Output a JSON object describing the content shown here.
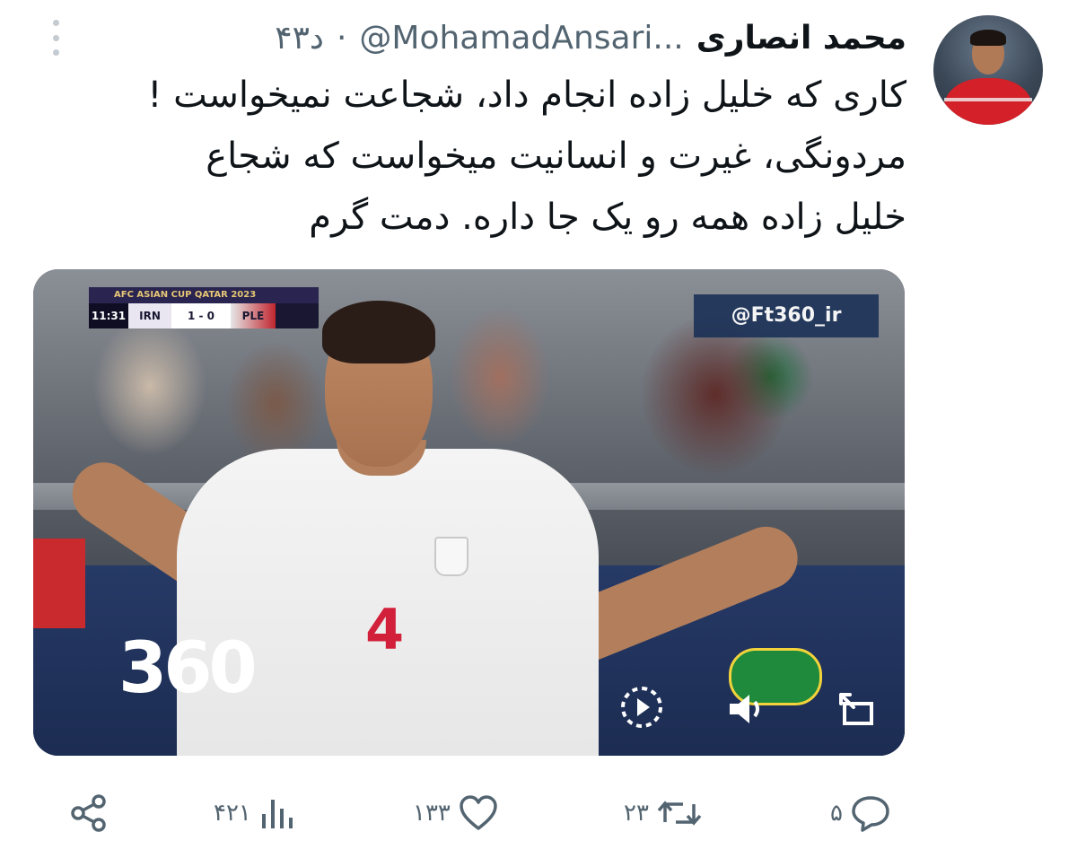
{
  "author": {
    "display_name": "محمد انصاری",
    "handle": "@MohamadAnsari...",
    "separator": "·",
    "time": "۴۳د"
  },
  "tweet": {
    "lines": [
      "کاری که خلیل زاده انجام داد، شجاعت نمیخواست !",
      "مردونگی، غیرت و انسانیت میخواست که شجاع",
      "خلیل زاده همه رو یک جا داره. دمت گرم"
    ]
  },
  "media": {
    "scorebug": {
      "title": "AFC ASIAN CUP QATAR 2023",
      "clock": "11:31",
      "home": "IRN",
      "score": "1 - 0",
      "away": "PLE"
    },
    "watermark": "@Ft360_ir",
    "channel_logo": "360",
    "jersey_number": "4"
  },
  "actions": {
    "reply_count": "۵",
    "retweet_count": "۲۳",
    "like_count": "۱۳۳",
    "views_count": "۴۲۱"
  },
  "colors": {
    "secondary_text": "#536471",
    "primary_text": "#0f1419"
  },
  "icons": [
    "more-icon",
    "reply-icon",
    "retweet-icon",
    "like-icon",
    "views-icon",
    "share-icon",
    "play-icon",
    "volume-icon",
    "expand-icon"
  ]
}
